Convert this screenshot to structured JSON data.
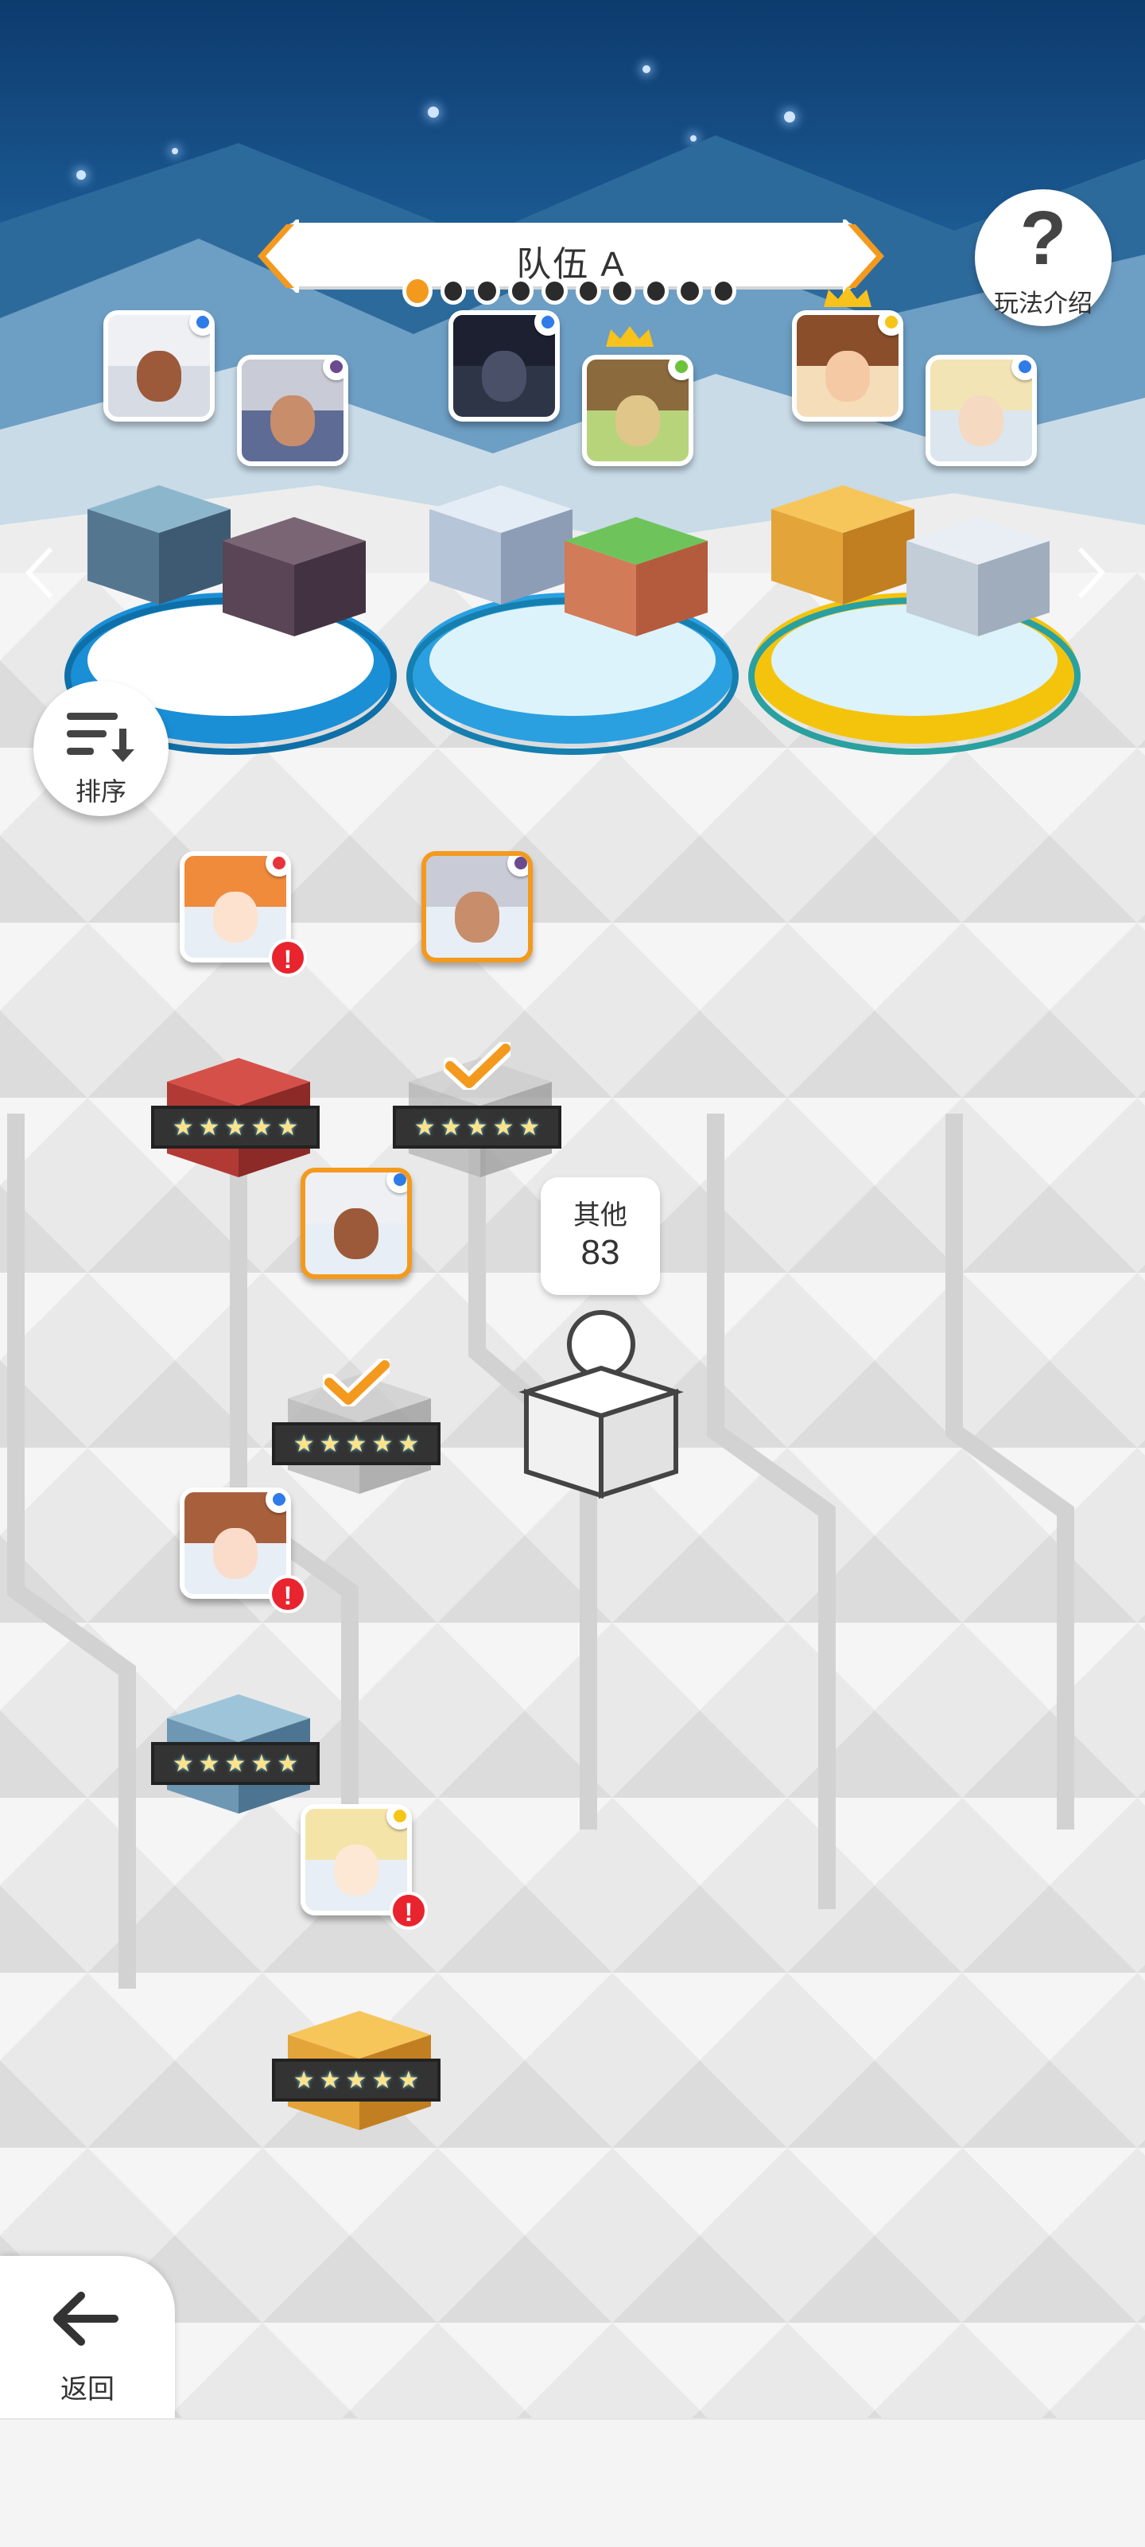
{
  "header": {
    "team_title": "队伍 A",
    "page_count": 10,
    "active_page": 1,
    "help_label": "玩法介绍"
  },
  "toolbar": {
    "sort_label": "排序",
    "back_label": "返回"
  },
  "teams": [
    {
      "members": [
        {
          "name": "white-hair-tan-girl",
          "element": "water"
        },
        {
          "name": "grey-hair-bearded-man",
          "element": "dark"
        }
      ],
      "ring": "blue"
    },
    {
      "members": [
        {
          "name": "dark-beast",
          "element": "water"
        },
        {
          "name": "owl",
          "element": "wind",
          "crown": true
        }
      ],
      "ring": "light-blue"
    },
    {
      "members": [
        {
          "name": "glasses-girl",
          "element": "thunder",
          "crown": true
        },
        {
          "name": "blonde-girl",
          "element": "water"
        }
      ],
      "ring": "gold"
    }
  ],
  "roster": [
    {
      "name": "orange-hair-girl",
      "element": "fire",
      "stars": 5,
      "alert": true,
      "selected": false
    },
    {
      "name": "grey-hair-bearded-man",
      "element": "dark",
      "stars": 5,
      "alert": false,
      "selected": true
    },
    {
      "name": "white-hair-tan-girl",
      "element": "water",
      "stars": 5,
      "alert": false,
      "selected": true
    },
    {
      "name": "brown-hair-girl",
      "element": "water",
      "stars": 5,
      "alert": true,
      "selected": false
    },
    {
      "name": "blonde-cat-girl",
      "element": "thunder",
      "stars": 5,
      "alert": true,
      "selected": false
    }
  ],
  "others": {
    "label": "其他",
    "count": "83"
  },
  "alert_symbol": "!",
  "star_symbol": "★",
  "colors": {
    "accent": "#f39a1e",
    "alert": "#e8242f",
    "water": "#2f7be8",
    "dark": "#6b4b8f",
    "fire": "#e8333c",
    "wind": "#6cc33b",
    "thunder": "#f5c518"
  }
}
